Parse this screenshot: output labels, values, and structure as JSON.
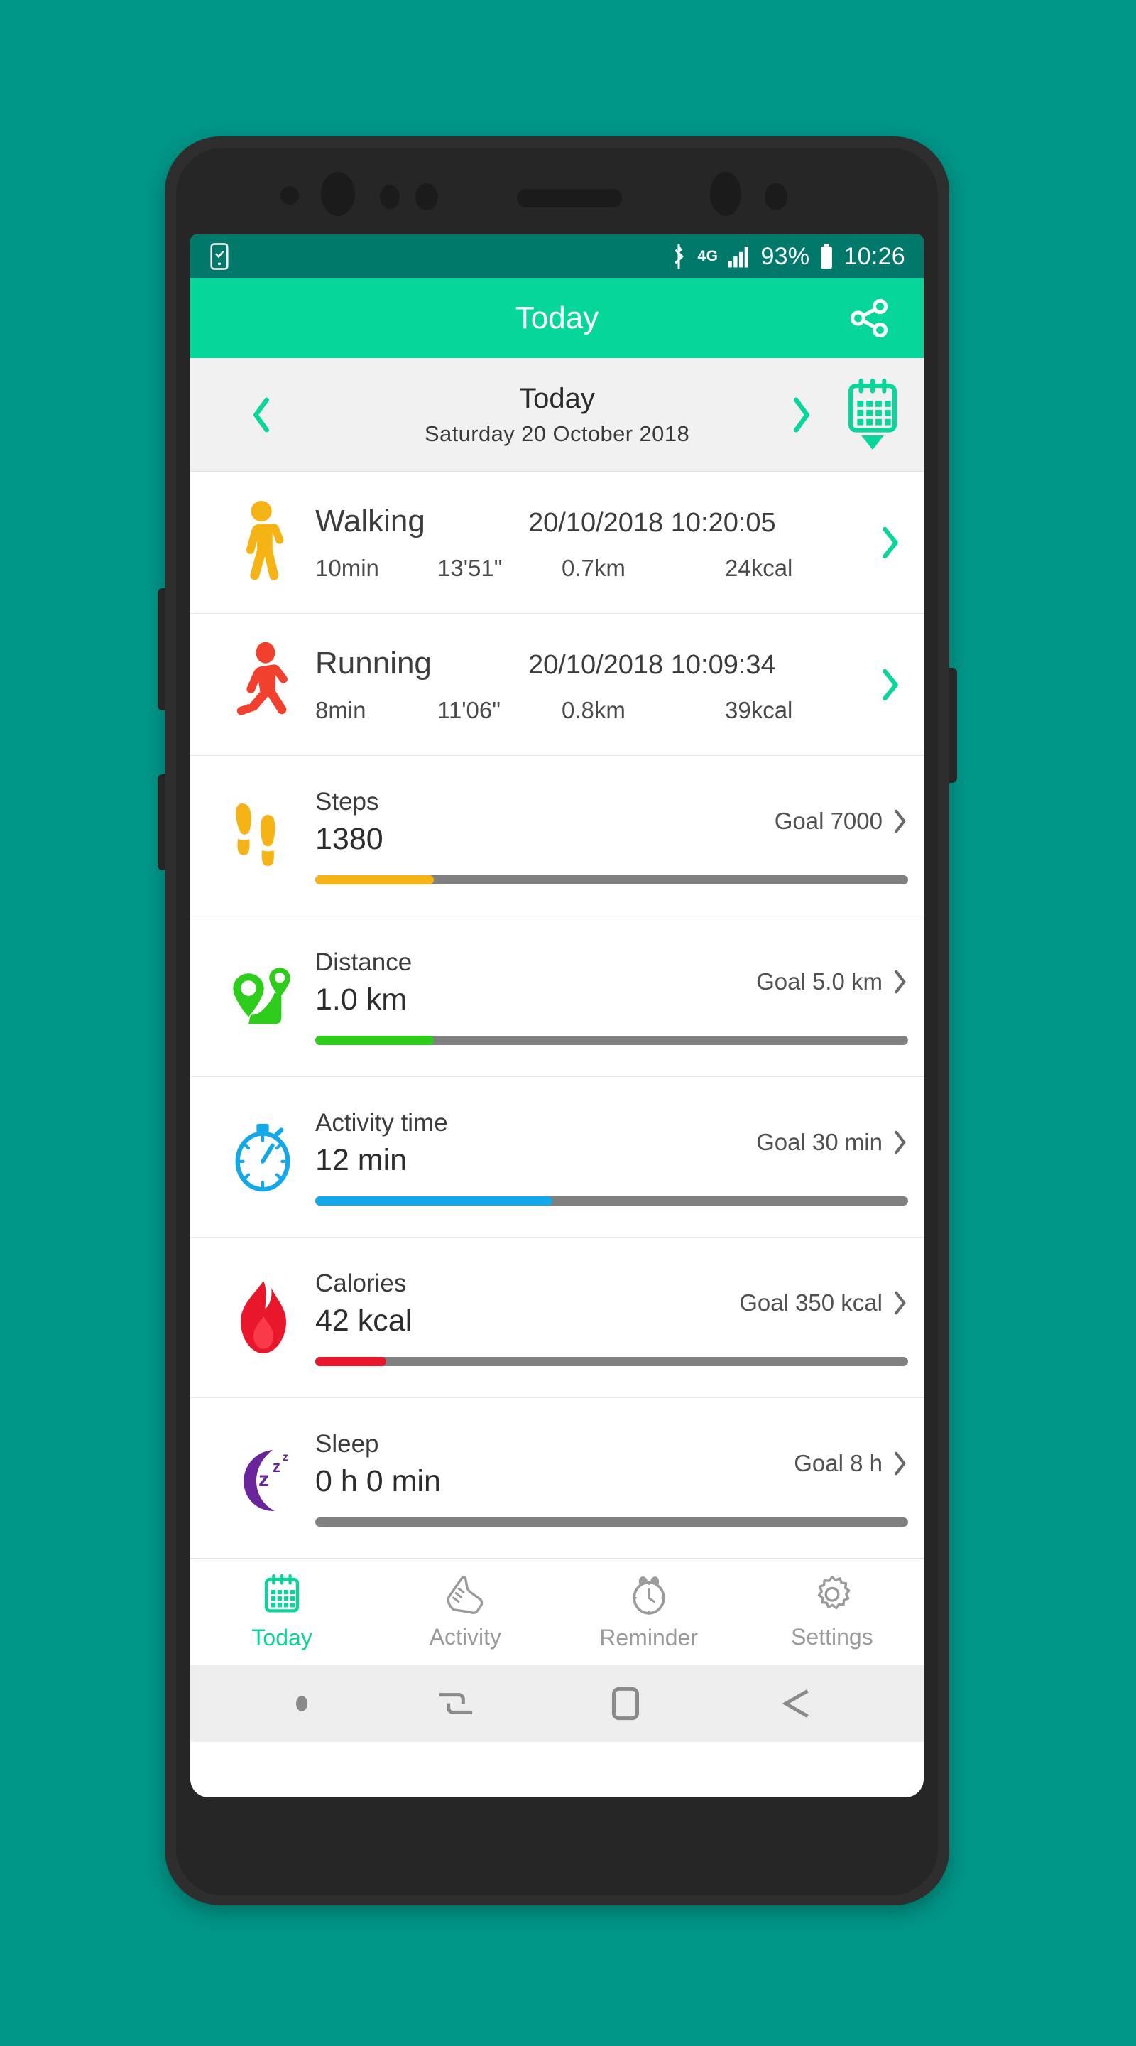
{
  "statusbar": {
    "left_icon": "device-check-icon",
    "bluetooth_icon": "bluetooth-icon",
    "network": "4G",
    "signal_icon": "signal-bars-icon",
    "battery_percent": "93%",
    "battery_icon": "battery-icon",
    "time": "10:26"
  },
  "appbar": {
    "title": "Today",
    "share_icon": "share-icon"
  },
  "datebar": {
    "prev_icon": "chevron-left-icon",
    "next_icon": "chevron-right-icon",
    "today_label": "Today",
    "full_date": "Saturday  20  October  2018",
    "calendar_icon": "calendar-icon",
    "calendar_dropdown_icon": "triangle-down-icon"
  },
  "activities": [
    {
      "icon": "walking-icon",
      "color": "#f5b316",
      "name": "Walking",
      "datetime": "20/10/2018 10:20:05",
      "duration": "10min",
      "pace": "13'51\"",
      "distance": "0.7km",
      "calories": "24kcal",
      "arrow_icon": "chevron-right-icon"
    },
    {
      "icon": "running-icon",
      "color": "#f2402e",
      "name": "Running",
      "datetime": "20/10/2018 10:09:34",
      "duration": "8min",
      "pace": "11'06\"",
      "distance": "0.8km",
      "calories": "39kcal",
      "arrow_icon": "chevron-right-icon"
    }
  ],
  "metrics": [
    {
      "icon": "footprints-icon",
      "color": "#f5b316",
      "label": "Steps",
      "value": "1380",
      "goal": "Goal 7000",
      "progress_percent": 20,
      "arrow_icon": "chevron-right-icon"
    },
    {
      "icon": "route-pin-icon",
      "color": "#2ecc1b",
      "label": "Distance",
      "value": "1.0 km",
      "goal": "Goal 5.0 km",
      "progress_percent": 20,
      "arrow_icon": "chevron-right-icon"
    },
    {
      "icon": "stopwatch-icon",
      "color": "#13a8ea",
      "label": "Activity time",
      "value": "12 min",
      "goal": "Goal 30 min",
      "progress_percent": 40,
      "arrow_icon": "chevron-right-icon"
    },
    {
      "icon": "flame-icon",
      "color": "#e8172b",
      "label": "Calories",
      "value": "42 kcal",
      "goal": "Goal 350 kcal",
      "progress_percent": 12,
      "arrow_icon": "chevron-right-icon"
    },
    {
      "icon": "moon-sleep-icon",
      "color": "#6a259c",
      "label": "Sleep",
      "value": "0 h 0 min",
      "goal": "Goal 8 h",
      "progress_percent": 0,
      "arrow_icon": "chevron-right-icon"
    }
  ],
  "tabs": [
    {
      "icon": "calendar-icon",
      "label": "Today",
      "active": true
    },
    {
      "icon": "shoe-icon",
      "label": "Activity",
      "active": false
    },
    {
      "icon": "alarm-clock-icon",
      "label": "Reminder",
      "active": false
    },
    {
      "icon": "gear-icon",
      "label": "Settings",
      "active": false
    }
  ],
  "android_nav": {
    "dot_icon": "dot-icon",
    "recents_icon": "recents-icon",
    "home_icon": "home-square-icon",
    "back_icon": "back-arrow-icon"
  },
  "colors": {
    "brand": "#07d69b",
    "statusbar": "#00796b",
    "background": "#009688",
    "track": "#808080"
  }
}
